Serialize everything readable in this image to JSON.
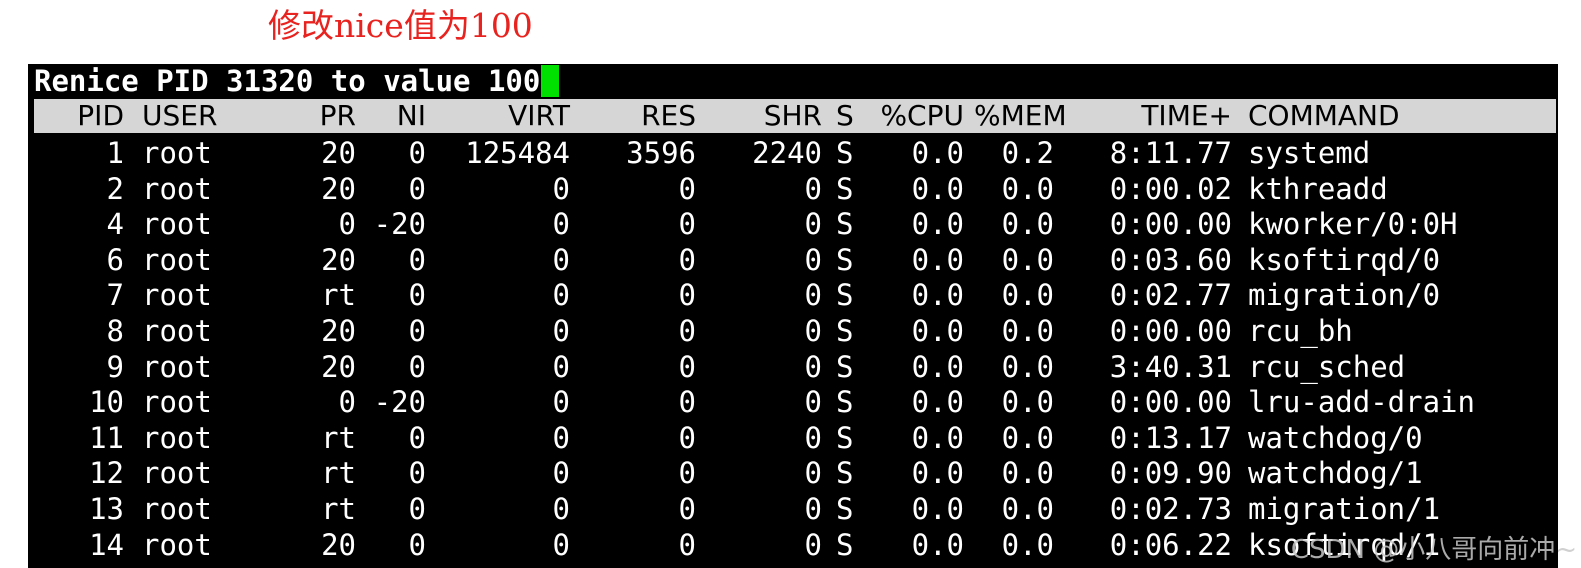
{
  "annotation": "修改nice值为100",
  "terminal": {
    "prompt": "Renice PID 31320 to value 100",
    "header": {
      "pid": "PID",
      "user": "USER",
      "pr": "PR",
      "ni": "NI",
      "virt": "VIRT",
      "res": "RES",
      "shr": "SHR",
      "s": "S",
      "cpu": "%CPU",
      "mem": "%MEM",
      "time": "TIME+",
      "command": "COMMAND"
    },
    "rows": [
      {
        "pid": "1",
        "user": "root",
        "pr": "20",
        "ni": "0",
        "virt": "125484",
        "res": "3596",
        "shr": "2240",
        "s": "S",
        "cpu": "0.0",
        "mem": "0.2",
        "time": "8:11.77",
        "command": "systemd"
      },
      {
        "pid": "2",
        "user": "root",
        "pr": "20",
        "ni": "0",
        "virt": "0",
        "res": "0",
        "shr": "0",
        "s": "S",
        "cpu": "0.0",
        "mem": "0.0",
        "time": "0:00.02",
        "command": "kthreadd"
      },
      {
        "pid": "4",
        "user": "root",
        "pr": "0",
        "ni": "-20",
        "virt": "0",
        "res": "0",
        "shr": "0",
        "s": "S",
        "cpu": "0.0",
        "mem": "0.0",
        "time": "0:00.00",
        "command": "kworker/0:0H"
      },
      {
        "pid": "6",
        "user": "root",
        "pr": "20",
        "ni": "0",
        "virt": "0",
        "res": "0",
        "shr": "0",
        "s": "S",
        "cpu": "0.0",
        "mem": "0.0",
        "time": "0:03.60",
        "command": "ksoftirqd/0"
      },
      {
        "pid": "7",
        "user": "root",
        "pr": "rt",
        "ni": "0",
        "virt": "0",
        "res": "0",
        "shr": "0",
        "s": "S",
        "cpu": "0.0",
        "mem": "0.0",
        "time": "0:02.77",
        "command": "migration/0"
      },
      {
        "pid": "8",
        "user": "root",
        "pr": "20",
        "ni": "0",
        "virt": "0",
        "res": "0",
        "shr": "0",
        "s": "S",
        "cpu": "0.0",
        "mem": "0.0",
        "time": "0:00.00",
        "command": "rcu_bh"
      },
      {
        "pid": "9",
        "user": "root",
        "pr": "20",
        "ni": "0",
        "virt": "0",
        "res": "0",
        "shr": "0",
        "s": "S",
        "cpu": "0.0",
        "mem": "0.0",
        "time": "3:40.31",
        "command": "rcu_sched"
      },
      {
        "pid": "10",
        "user": "root",
        "pr": "0",
        "ni": "-20",
        "virt": "0",
        "res": "0",
        "shr": "0",
        "s": "S",
        "cpu": "0.0",
        "mem": "0.0",
        "time": "0:00.00",
        "command": "lru-add-drain"
      },
      {
        "pid": "11",
        "user": "root",
        "pr": "rt",
        "ni": "0",
        "virt": "0",
        "res": "0",
        "shr": "0",
        "s": "S",
        "cpu": "0.0",
        "mem": "0.0",
        "time": "0:13.17",
        "command": "watchdog/0"
      },
      {
        "pid": "12",
        "user": "root",
        "pr": "rt",
        "ni": "0",
        "virt": "0",
        "res": "0",
        "shr": "0",
        "s": "S",
        "cpu": "0.0",
        "mem": "0.0",
        "time": "0:09.90",
        "command": "watchdog/1"
      },
      {
        "pid": "13",
        "user": "root",
        "pr": "rt",
        "ni": "0",
        "virt": "0",
        "res": "0",
        "shr": "0",
        "s": "S",
        "cpu": "0.0",
        "mem": "0.0",
        "time": "0:02.73",
        "command": "migration/1"
      },
      {
        "pid": "14",
        "user": "root",
        "pr": "20",
        "ni": "0",
        "virt": "0",
        "res": "0",
        "shr": "0",
        "s": "S",
        "cpu": "0.0",
        "mem": "0.0",
        "time": "0:06.22",
        "command": "ksoftirqd/1"
      }
    ]
  },
  "watermark": "CSDN @小八哥向前冲~",
  "colors": {
    "annotation": "#e8231f",
    "terminal_bg": "#000000",
    "header_bg": "#d6d6d6",
    "cursor": "#00e000"
  }
}
